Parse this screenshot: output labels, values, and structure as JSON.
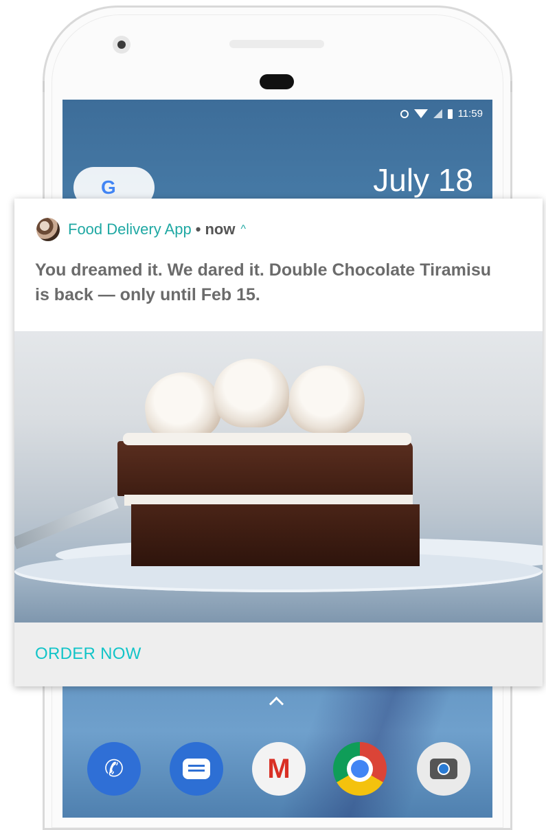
{
  "status_bar": {
    "time": "11:59",
    "icons": [
      "alarm-icon",
      "wifi-icon",
      "signal-icon",
      "battery-icon"
    ]
  },
  "home_screen": {
    "date": "July 18",
    "search_logo": "G",
    "dock_apps": [
      "phone",
      "messages",
      "gmail",
      "chrome",
      "camera"
    ]
  },
  "notification": {
    "app_name": "Food Delivery App",
    "separator": "•",
    "time": "now",
    "expand_icon": "^",
    "message": "You dreamed it. We dared it. Double Chocolate Tiramisu is back — only until Feb 15.",
    "action_label": "ORDER NOW",
    "accent_color": "#1fa8a3",
    "action_color": "#12c4c8"
  },
  "dock_glyphs": {
    "phone": "✆",
    "gmail": "M"
  }
}
